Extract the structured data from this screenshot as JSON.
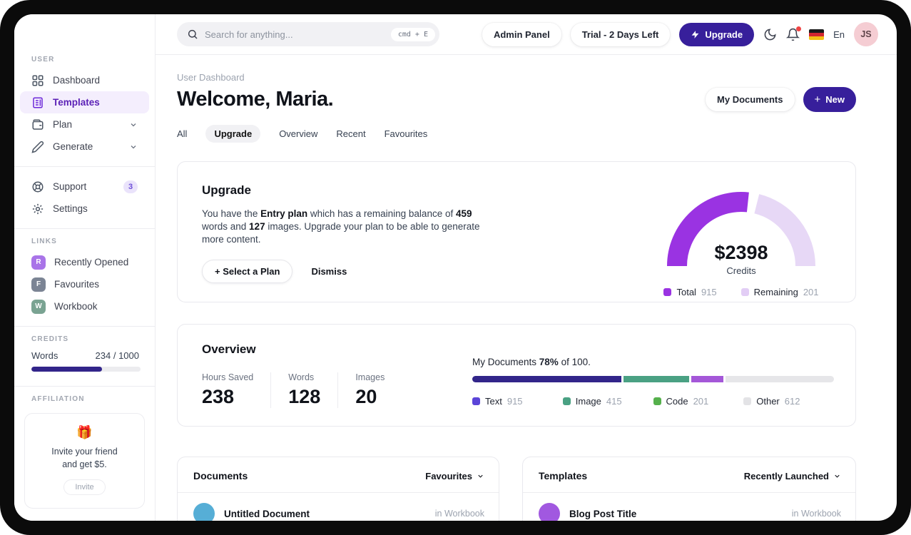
{
  "colors": {
    "accent_dark": "#371f9b",
    "active_purple": "#6d28d9",
    "gauge_purple": "#9a33e2",
    "gauge_light": "#e7d8f6",
    "notification_red": "#ef4444"
  },
  "sidebar": {
    "sections": {
      "user": "USER",
      "links": "LINKS",
      "credits": "CREDITS",
      "affiliation": "AFFILIATION"
    },
    "user_items": [
      {
        "label": "Dashboard"
      },
      {
        "label": "Templates",
        "active": true
      },
      {
        "label": "Plan",
        "chevron": true
      },
      {
        "label": "Generate",
        "chevron": true
      }
    ],
    "secondary_items": [
      {
        "label": "Support",
        "badge": "3"
      },
      {
        "label": "Settings"
      }
    ],
    "links": [
      {
        "badge": "R",
        "label": "Recently Opened",
        "color": "#a974e8"
      },
      {
        "badge": "F",
        "label": "Favourites",
        "color": "#7b8494"
      },
      {
        "badge": "W",
        "label": "Workbook",
        "color": "#7aa392"
      }
    ],
    "credits": {
      "label": "Words",
      "value": "234 / 1000",
      "pct": 65
    },
    "affiliation": {
      "emoji": "🎁",
      "line1": "Invite your friend",
      "line2": "and get $5.",
      "button": "Invite"
    }
  },
  "topbar": {
    "search": {
      "placeholder": "Search for anything...",
      "shortcut": "cmd + E",
      "icon": "magnifier-icon"
    },
    "admin_panel": "Admin Panel",
    "trial_badge": "Trial - 2 Days Left",
    "upgrade_label": "Upgrade",
    "icons": {
      "theme": "crescent-moon",
      "notifications": "bell-with-red-dot",
      "flag": "german-flag"
    },
    "language": "En",
    "avatar_initials": "JS"
  },
  "header": {
    "breadcrumb": "User Dashboard",
    "title": "Welcome, Maria.",
    "my_documents_label": "My Documents",
    "new_label": "New",
    "tabs": [
      {
        "label": "All"
      },
      {
        "label": "Upgrade",
        "active": true
      },
      {
        "label": "Overview"
      },
      {
        "label": "Recent"
      },
      {
        "label": "Favourites"
      }
    ]
  },
  "upgrade_card": {
    "title": "Upgrade",
    "body": {
      "p1": "You have the ",
      "b1": "Entry plan",
      "p2": " which has a remaining balance of ",
      "b2": "459",
      "p3": " words and ",
      "b3": "127",
      "p4": " images. Upgrade your plan to be able to generate more content."
    },
    "select_plan_label": "Select a Plan",
    "dismiss_label": "Dismiss",
    "gauge": {
      "amount": "$2398",
      "caption": "Credits",
      "legend": [
        {
          "label": "Total",
          "value": "915",
          "color": "#9a33e2"
        },
        {
          "label": "Remaining",
          "value": "201",
          "color": "#e2cdf5"
        }
      ]
    }
  },
  "overview_card": {
    "title": "Overview",
    "stats": [
      {
        "label": "Hours Saved",
        "value": "238"
      },
      {
        "label": "Words",
        "value": "128"
      },
      {
        "label": "Images",
        "value": "20"
      }
    ],
    "progress_caption": {
      "t1": "My Documents ",
      "b": "78%",
      "t2": " of 100."
    },
    "bar_segments": [
      {
        "label": "Text",
        "value": "915",
        "pct": 42,
        "bar_color": "#32258a",
        "legend_color": "#5b45d8"
      },
      {
        "label": "Image",
        "value": "415",
        "pct": 18.5,
        "bar_color": "#4aa183",
        "legend_color": "#4aa183"
      },
      {
        "label": "Code",
        "value": "201",
        "pct": 9,
        "bar_color": "#a457d8",
        "legend_color": "#55b04c"
      },
      {
        "label": "Other",
        "value": "612",
        "pct": 30.5,
        "bar_color": "#e6e6e9",
        "legend_color": "#e3e3e6"
      }
    ]
  },
  "documents_card": {
    "title": "Documents",
    "filter": "Favourites",
    "row": {
      "title": "Untitled Document",
      "meta": "in Workbook",
      "avatar_color": "#56aed6"
    }
  },
  "templates_card": {
    "title": "Templates",
    "filter": "Recently Launched",
    "row": {
      "title": "Blog Post Title",
      "meta": "in Workbook",
      "avatar_color": "#a158e0"
    }
  }
}
